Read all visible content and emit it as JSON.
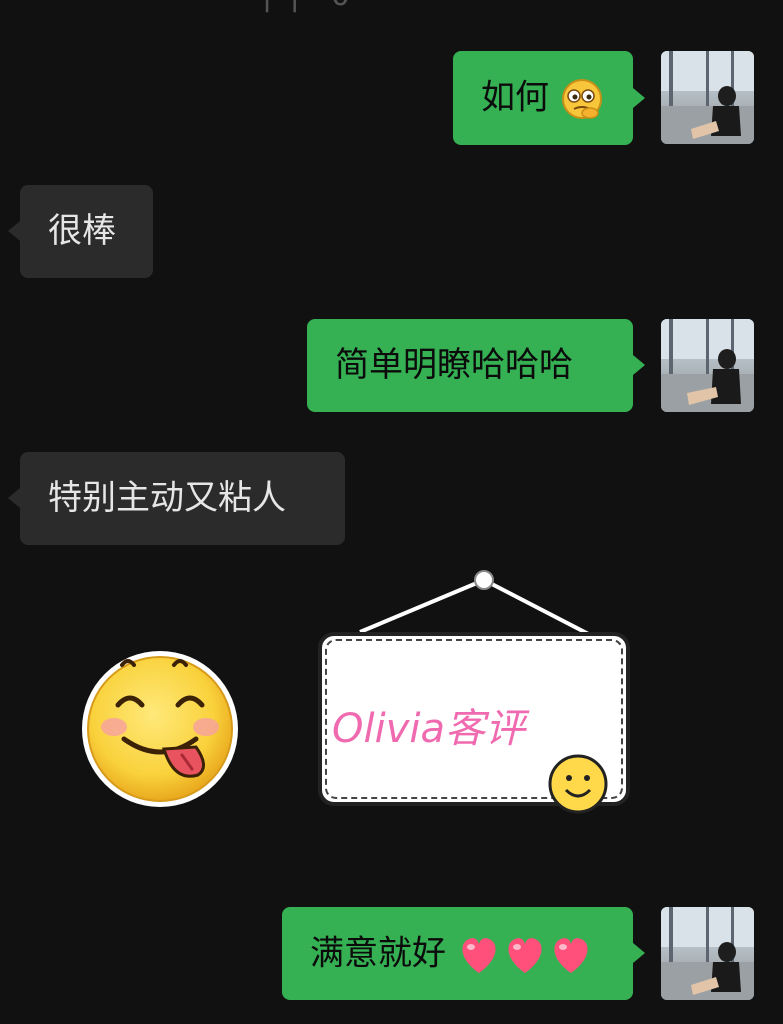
{
  "messages": [
    {
      "id": 1,
      "direction": "out",
      "text": "如何",
      "emoji": "thinking-face-emoji"
    },
    {
      "id": 2,
      "direction": "in",
      "text": "很棒"
    },
    {
      "id": 3,
      "direction": "out",
      "text": "简单明瞭哈哈哈"
    },
    {
      "id": 4,
      "direction": "in",
      "text": "特别主动又粘人"
    },
    {
      "id": 5,
      "direction": "in",
      "type": "stickers",
      "stickers": [
        {
          "name": "tongue-out-smiley-sticker"
        },
        {
          "name": "hanging-sign-sticker",
          "text": "Olivia客评"
        }
      ]
    },
    {
      "id": 6,
      "direction": "out",
      "text": "满意就好",
      "emoji": "heart-emoji",
      "emoji_count": 3
    }
  ],
  "colors": {
    "background": "#111111",
    "outgoing_bubble": "#35b053",
    "incoming_bubble": "#2b2b2b",
    "sign_text": "#f06ab0"
  }
}
